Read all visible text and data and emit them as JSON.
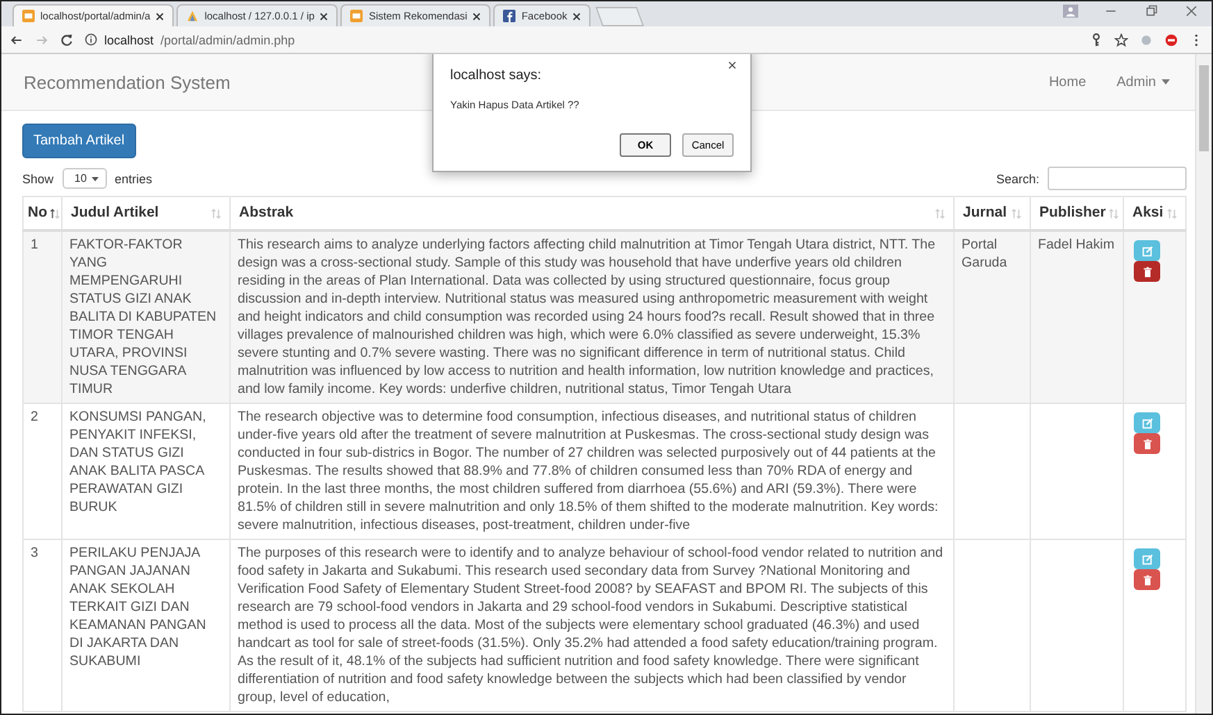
{
  "browser": {
    "tabs": [
      {
        "title": "localhost/portal/admin/a",
        "selected": true,
        "kind": "orange"
      },
      {
        "title": "localhost / 127.0.0.1 / ip",
        "selected": false,
        "kind": "pma"
      },
      {
        "title": "Sistem Rekomendasi",
        "selected": false,
        "kind": "orange"
      },
      {
        "title": "Facebook",
        "selected": false,
        "kind": "facebook"
      }
    ],
    "url_host": "localhost",
    "url_path": "/portal/admin/admin.php"
  },
  "navbar": {
    "brand": "Recommendation System",
    "links": [
      "Home",
      "Admin"
    ]
  },
  "add_button": "Tambah Artikel",
  "length": {
    "show": "Show",
    "value": "10",
    "entries": "entries"
  },
  "search": {
    "label": "Search:"
  },
  "table": {
    "columns": [
      {
        "label": "No",
        "sorted": true
      },
      {
        "label": "Judul Artikel",
        "sorted": false
      },
      {
        "label": "Abstrak",
        "sorted": false
      },
      {
        "label": "Jurnal",
        "sorted": false
      },
      {
        "label": "Publisher",
        "sorted": false
      },
      {
        "label": "Aksi",
        "sorted": false
      }
    ],
    "rows": [
      {
        "no": "1",
        "highlighted": true,
        "title": "FAKTOR-FAKTOR YANG MEMPENGARUHI STATUS GIZI ANAK BALITA DI KABUPATEN TIMOR TENGAH UTARA, PROVINSI NUSA TENGGARA TIMUR",
        "abstract": "This research aims to analyze underlying factors affecting child malnutrition at Timor Tengah Utara district, NTT. The design was a cross-sectional study. Sample of this study was household that have underfive years old children residing in the areas of Plan International. Data was collected by using structured questionnaire, focus group discussion and in-depth interview. Nutritional status was measured using anthropometric measurement with weight and height indicators and child consumption was recorded using 24 hours food?s recall. Result showed that in three villages prevalence of malnourished children was high, which were 6.0% classified as severe underweight, 15.3% severe stunting and 0.7% severe wasting. There was no significant difference in term of nutritional status. Child malnutrition was influenced by low access to nutrition and health information, low nutrition knowledge and practices, and low family income. Key words: underfive children, nutritional status, Timor Tengah Utara",
        "journal": "Portal Garuda",
        "publisher": "Fadel Hakim"
      },
      {
        "no": "2",
        "highlighted": false,
        "title": "KONSUMSI PANGAN, PENYAKIT INFEKSI, DAN STATUS GIZI ANAK BALITA PASCA PERAWATAN GIZI BURUK",
        "abstract": "The research objective was to determine food consumption, infectious diseases, and nutritional status of children under-five years old after the treatment of severe malnutrition at Puskesmas. The cross-sectional study design was conducted in four sub-districs in Bogor. The number of 27 children was selected purposively out of 44 patients at the Puskesmas. The results showed that 88.9% and 77.8% of children consumed less than 70% RDA of energy and protein. In the last three months, the most children suffered from diarrhoea (55.6%) and ARI (59.3%). There were 81.5% of children still in severe malnutrition and only 18.5% of them shifted to the moderate malnutrition. Key words: severe malnutrition, infectious diseases, post-treatment, children under-five",
        "journal": "",
        "publisher": ""
      },
      {
        "no": "3",
        "highlighted": false,
        "title": "PERILAKU PENJAJA PANGAN JAJANAN ANAK SEKOLAH TERKAIT GIZI DAN KEAMANAN PANGAN DI JAKARTA DAN SUKABUMI",
        "abstract": "The purposes of this research were to identify and to analyze behaviour of school-food vendor related to nutrition and food safety in Jakarta and Sukabumi. This research used secondary data from Survey ?National Monitoring and Verification Food Safety of Elementary Student Street-food 2008? by SEAFAST and BPOM RI. The subjects of this research are 79 school-food vendors in Jakarta and 29 school-food vendors in Sukabumi. Descriptive statistical method is used to process all the data. Most of the subjects were elementary school graduated (46.3%) and used handcart as tool for sale of street-foods (31.5%). Only 35.2% had attended a food safety education/training program. As the result of it, 48.1% of the subjects had sufficient nutrition and food safety knowledge. There were significant differentiation of nutrition and food safety knowledge between the subjects which had been classified by vendor group, level of education,",
        "journal": "",
        "publisher": ""
      }
    ]
  },
  "dialog": {
    "title": "localhost says:",
    "message": "Yakin Hapus Data Artikel ??",
    "buttons": [
      "OK",
      "Cancel"
    ]
  }
}
